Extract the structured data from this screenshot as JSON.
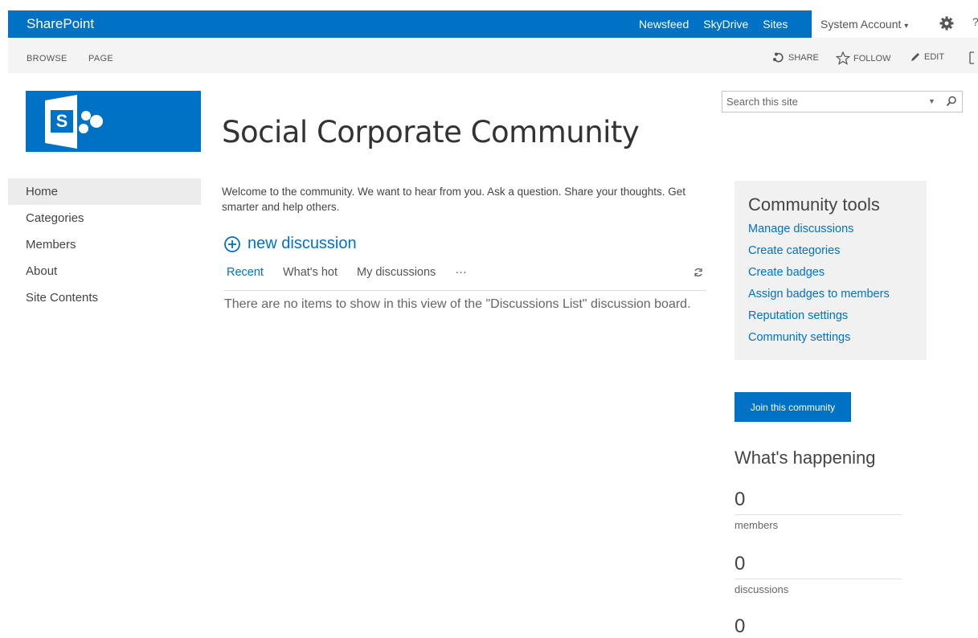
{
  "suitebar": {
    "brand": "SharePoint",
    "links": [
      "Newsfeed",
      "SkyDrive",
      "Sites"
    ],
    "account": "System Account",
    "account_caret": "▾",
    "icons": [
      "gear-icon",
      "help-icon"
    ]
  },
  "ribbon": {
    "tabs": [
      "BROWSE",
      "PAGE"
    ],
    "actions": {
      "share": "SHARE",
      "follow": "FOLLOW",
      "edit": "EDIT"
    }
  },
  "site": {
    "logo_letter": "S",
    "title": "Social Corporate Community"
  },
  "search": {
    "placeholder": "Search this site"
  },
  "leftnav": {
    "items": [
      "Home",
      "Categories",
      "Members",
      "About",
      "Site Contents"
    ],
    "selected": "Home"
  },
  "main": {
    "welcome": "Welcome to the community. We want to hear from you. Ask a question. Share your thoughts. Get smarter and help others.",
    "new_discussion": "new discussion",
    "tabs": [
      "Recent",
      "What's hot",
      "My discussions"
    ],
    "tabs_more": "···",
    "empty_message": "There are no items to show in this view of the \"Discussions List\" discussion board."
  },
  "tools": {
    "title": "Community tools",
    "links": [
      "Manage discussions",
      "Create categories",
      "Create badges",
      "Assign badges to members",
      "Reputation settings",
      "Community settings"
    ]
  },
  "join_button": "Join this community",
  "whats_happening": {
    "title": "What's happening",
    "stats": [
      {
        "value": "0",
        "label": "members"
      },
      {
        "value": "0",
        "label": "discussions"
      },
      {
        "value": "0",
        "label": ""
      }
    ]
  },
  "colors": {
    "brand_blue": "#0072c6"
  }
}
